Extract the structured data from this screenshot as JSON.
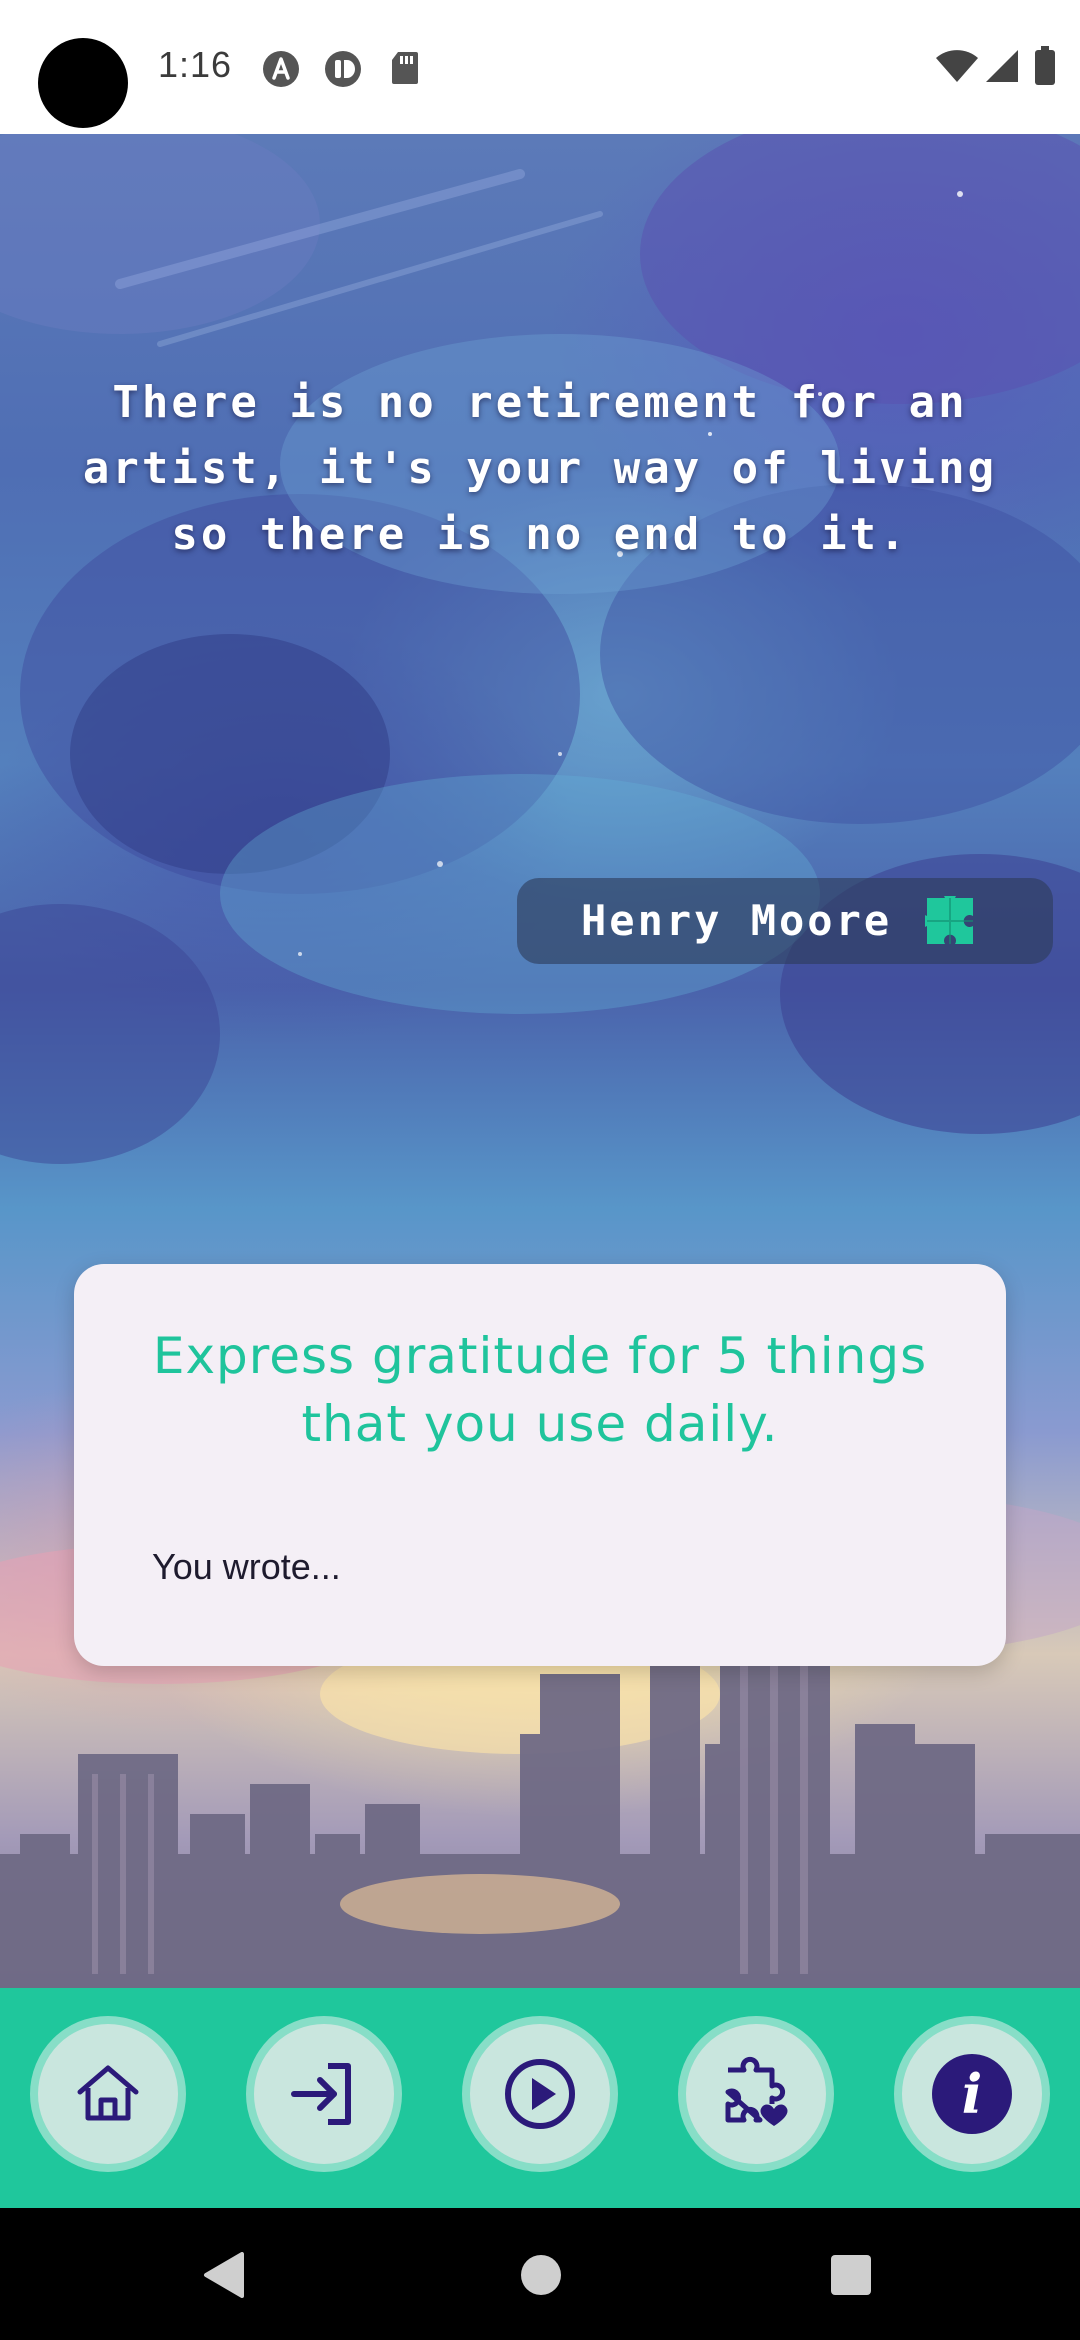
{
  "status_bar": {
    "time": "1:16",
    "left_icons": [
      "accessibility-a-icon",
      "pause-badge-icon",
      "sd-card-icon"
    ],
    "right_icons": [
      "wifi-icon",
      "cell-signal-icon",
      "battery-icon"
    ]
  },
  "quote": {
    "text": "There is no retirement for an artist, it's your way of living so there is no end to it.",
    "author": "Henry Moore",
    "author_icon": "puzzle-icon"
  },
  "prompt": {
    "title": "Express gratitude for 5 things that you use daily.",
    "answer_placeholder": "You wrote..."
  },
  "bottom_nav": {
    "items": [
      {
        "id": "home",
        "icon": "home-icon"
      },
      {
        "id": "login",
        "icon": "login-arrow-icon"
      },
      {
        "id": "play",
        "icon": "play-circle-icon"
      },
      {
        "id": "favorites",
        "icon": "puzzle-heart-icon"
      },
      {
        "id": "info",
        "icon": "info-icon",
        "glyph": "i"
      }
    ]
  },
  "system_nav": {
    "buttons": [
      "back-icon",
      "home-circle-icon",
      "recents-square-icon"
    ]
  },
  "colors": {
    "accent": "#1fc79c",
    "nav_icon": "#2b1a7a",
    "card_bg": "#f4eff6",
    "prompt_text": "#1fc49c"
  }
}
